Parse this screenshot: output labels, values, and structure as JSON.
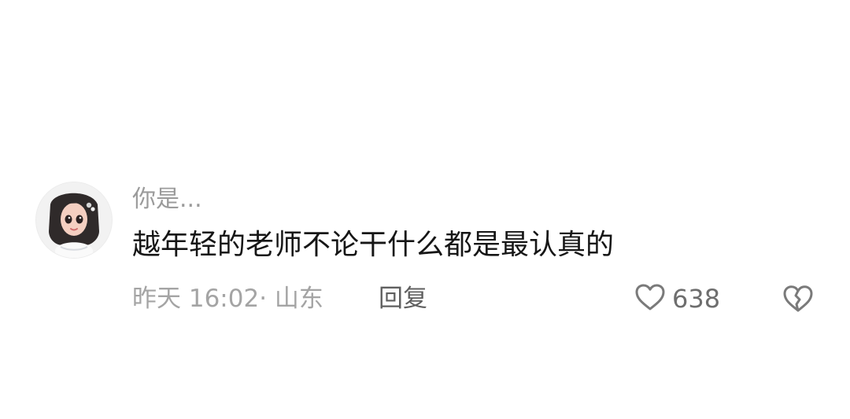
{
  "comment": {
    "username": "你是...",
    "text": "越年轻的老师不论干什么都是最认真的",
    "meta": "昨天 16:02· 山东",
    "reply_label": "回复",
    "like_count": "638",
    "icons": {
      "avatar": "avatar-girl-illustration",
      "like": "heart-outline-icon",
      "dislike": "broken-heart-outline-icon"
    },
    "colors": {
      "username": "#9b9b9b",
      "text": "#161616",
      "meta": "#a4a4a4",
      "reply": "#5f5f5f",
      "icon": "#7a7a7a"
    }
  }
}
